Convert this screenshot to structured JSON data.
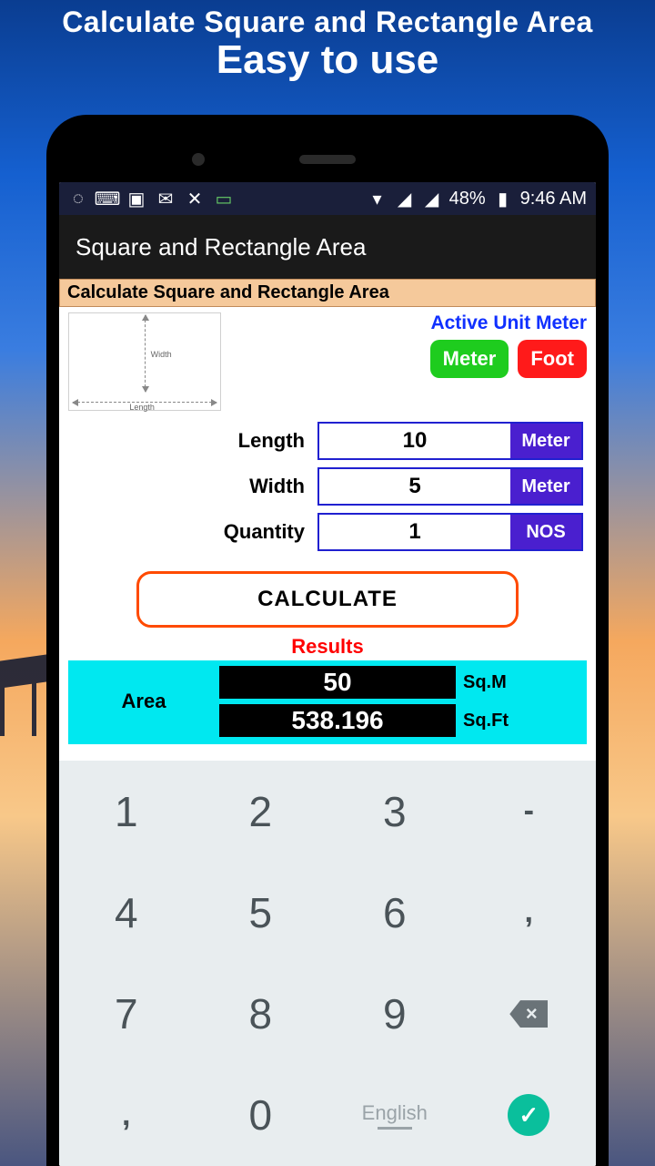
{
  "promo": {
    "line1": "Calculate Square and Rectangle Area",
    "line2": "Easy to use"
  },
  "statusbar": {
    "battery": "48%",
    "time": "9:46 AM"
  },
  "appbar": {
    "title": "Square and Rectangle Area"
  },
  "section": {
    "header": "Calculate Square and Rectangle Area"
  },
  "diagram": {
    "width_label": "Width",
    "length_label": "Length"
  },
  "units": {
    "active_label": "Active Unit Meter",
    "meter": "Meter",
    "foot": "Foot"
  },
  "inputs": {
    "length": {
      "label": "Length",
      "value": "10",
      "unit": "Meter"
    },
    "width": {
      "label": "Width",
      "value": "5",
      "unit": "Meter"
    },
    "qty": {
      "label": "Quantity",
      "value": "1",
      "unit": "NOS"
    }
  },
  "calc_label": "CALCULATE",
  "results": {
    "label": "Results",
    "area_label": "Area",
    "sqm": {
      "value": "50",
      "unit": "Sq.M"
    },
    "sqft": {
      "value": "538.196",
      "unit": "Sq.Ft"
    }
  },
  "keyboard": {
    "rows": [
      [
        "1",
        "2",
        "3",
        "-"
      ],
      [
        "4",
        "5",
        "6",
        ","
      ],
      [
        "7",
        "8",
        "9",
        "backspace"
      ],
      [
        ",",
        "0",
        "English",
        "done"
      ]
    ],
    "lang": "English"
  }
}
